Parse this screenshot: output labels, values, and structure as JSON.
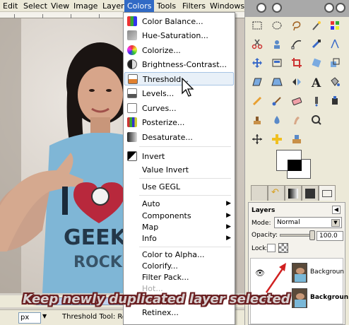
{
  "menubar": {
    "items": [
      "Edit",
      "Select",
      "View",
      "Image",
      "Layer",
      "Colors",
      "Tools",
      "Filters",
      "Windows"
    ],
    "active": "Colors"
  },
  "colors_menu": {
    "items": [
      {
        "label": "Color Balance...",
        "icon": "color-balance-icon"
      },
      {
        "label": "Hue-Saturation...",
        "icon": "hue-saturation-icon"
      },
      {
        "label": "Colorize...",
        "icon": "colorize-icon"
      },
      {
        "label": "Brightness-Contrast...",
        "icon": "brightness-contrast-icon"
      },
      {
        "label": "Threshold...",
        "icon": "threshold-icon",
        "highlighted": true
      },
      {
        "label": "Levels...",
        "icon": "levels-icon"
      },
      {
        "label": "Curves...",
        "icon": "curves-icon"
      },
      {
        "label": "Posterize...",
        "icon": "posterize-icon"
      },
      {
        "label": "Desaturate...",
        "icon": "desaturate-icon"
      },
      {
        "label": "Invert",
        "icon": "invert-icon"
      },
      {
        "label": "Value Invert",
        "icon": ""
      },
      {
        "label": "Use GEGL",
        "icon": ""
      },
      {
        "label": "Auto",
        "submenu": true
      },
      {
        "label": "Components",
        "submenu": true
      },
      {
        "label": "Map",
        "submenu": true
      },
      {
        "label": "Info",
        "submenu": true
      },
      {
        "label": "Color to Alpha..."
      },
      {
        "label": "Colorify..."
      },
      {
        "label": "Filter Pack..."
      },
      {
        "label": "Hot...",
        "disabled": true
      },
      {
        "label": "Retinex..."
      }
    ]
  },
  "statusbar": {
    "unit": "px",
    "text": "Threshold Tool: Re"
  },
  "layers": {
    "title": "Layers",
    "mode_label": "Mode:",
    "mode_value": "Normal",
    "opacity_label": "Opacity:",
    "opacity_value": "100.0",
    "lock_label": "Lock:",
    "items": [
      {
        "name": "Backgroun",
        "bold": false
      },
      {
        "name": "Backgroun",
        "bold": true
      }
    ]
  },
  "caption": "Keep newly duplicated layer selected",
  "accent": "#316ac5",
  "highlight": "#e8f0f8"
}
